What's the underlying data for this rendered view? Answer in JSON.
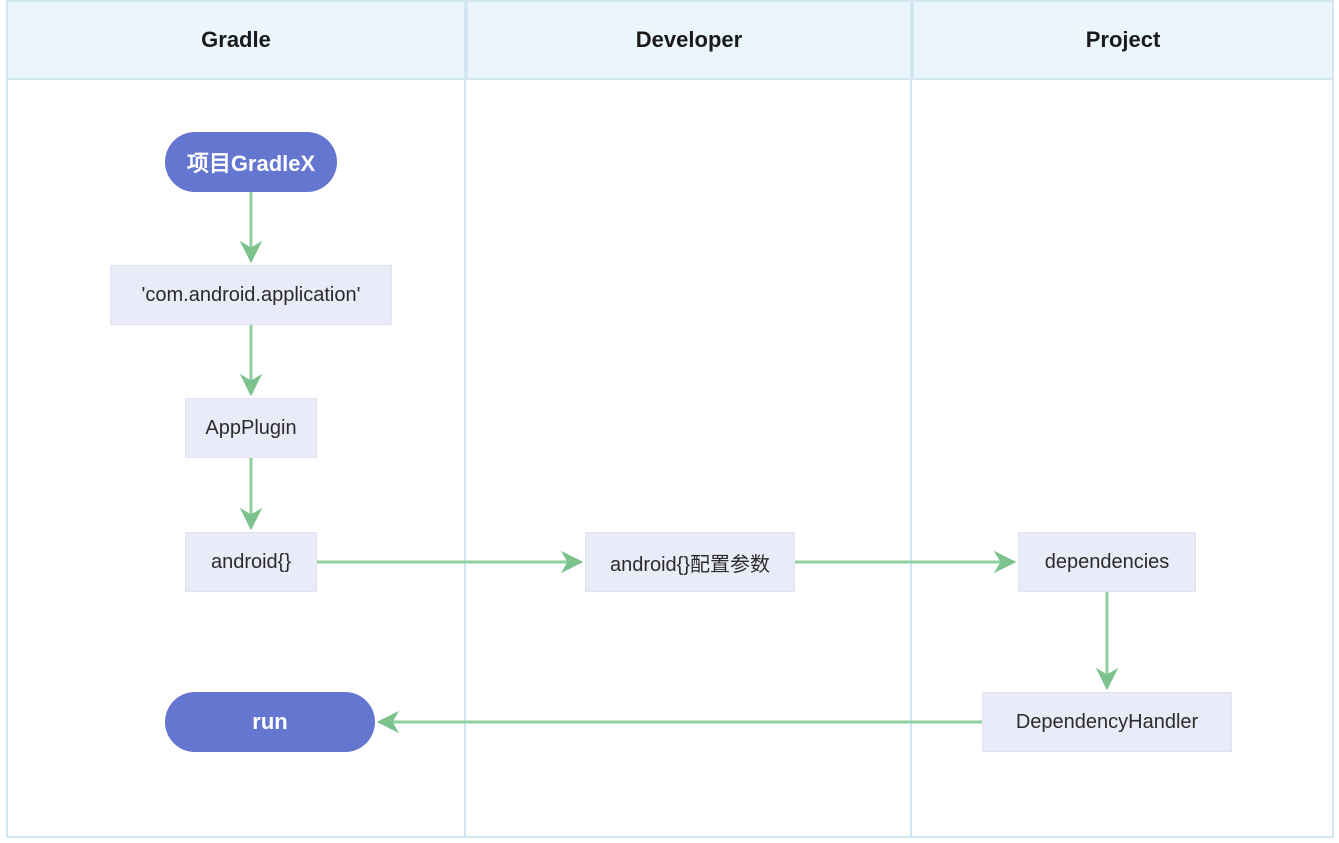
{
  "lanes": {
    "gradle": "Gradle",
    "developer": "Developer",
    "project": "Project"
  },
  "nodes": {
    "start": "项目GradleX",
    "plugin_id": "'com.android.application'",
    "app_plugin": "AppPlugin",
    "android_block": "android{}",
    "android_config": "android{}配置参数",
    "dependencies": "dependencies",
    "dep_handler": "DependencyHandler",
    "run": "run"
  },
  "colors": {
    "lane_header_bg": "#eaf5fc",
    "lane_border": "#d1e6f0",
    "box_bg": "#e9ebf8",
    "pill_bg": "#6476cf",
    "arrow": "#8fd19e",
    "arrow_stroke": "#7bc28c"
  }
}
